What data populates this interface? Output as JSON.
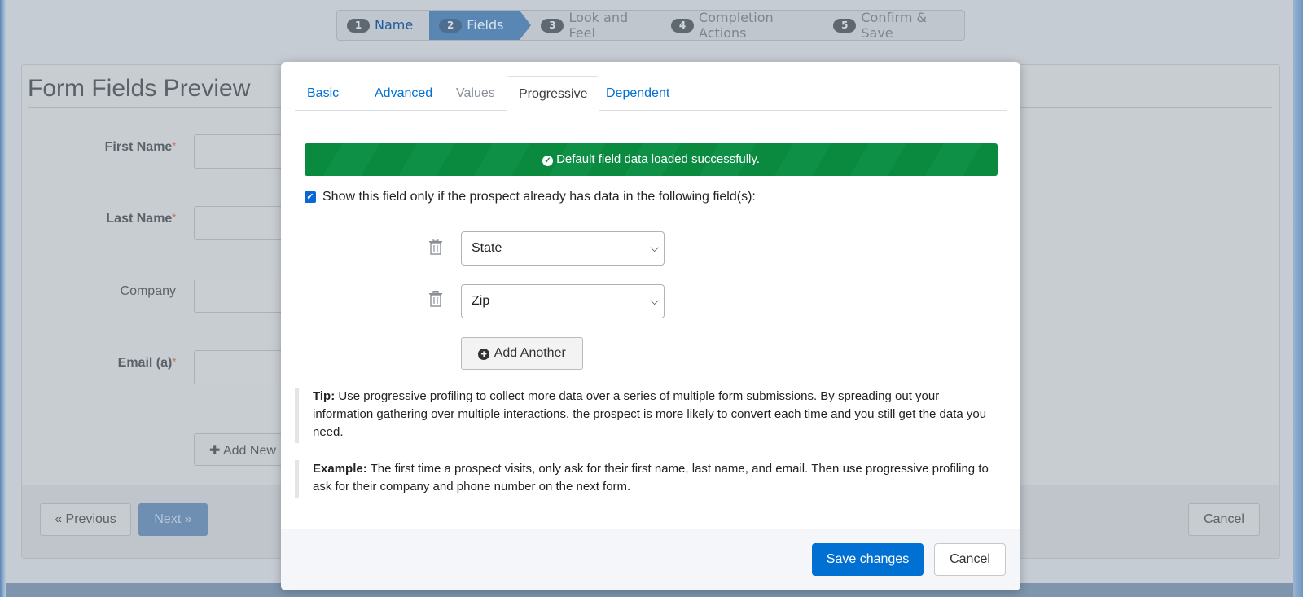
{
  "wizard": {
    "steps": [
      {
        "num": "1",
        "label": "Name"
      },
      {
        "num": "2",
        "label": "Fields"
      },
      {
        "num": "3",
        "label": "Look and Feel"
      },
      {
        "num": "4",
        "label": "Completion Actions"
      },
      {
        "num": "5",
        "label": "Confirm & Save"
      }
    ],
    "active_step": 2
  },
  "background": {
    "title": "Form Fields Preview",
    "fields": [
      {
        "label": "First Name",
        "required": "*"
      },
      {
        "label": "Last Name",
        "required": "*"
      },
      {
        "label": "Company",
        "required": ""
      },
      {
        "label": "Email (a)",
        "required": "*"
      }
    ],
    "add_new_label": "Add New",
    "prev_label": "« Previous",
    "next_label": "Next »",
    "cancel_label": "Cancel"
  },
  "modal": {
    "tabs": [
      {
        "label": "Basic"
      },
      {
        "label": "Advanced"
      },
      {
        "label": "Values"
      },
      {
        "label": "Progressive"
      },
      {
        "label": "Dependent"
      }
    ],
    "active_tab": "Progressive",
    "alert": "Default field data loaded successfully.",
    "checkbox_label": "Show this field only if the prospect already has data in the following field(s):",
    "checkbox_checked": true,
    "conditions": [
      {
        "value": "State"
      },
      {
        "value": "Zip"
      }
    ],
    "add_another_label": "Add Another",
    "tip": {
      "heading": "Tip:",
      "text": "Use progressive profiling to collect more data over a series of multiple form submissions. By spreading out your information gathering over multiple interactions, the prospect is more likely to convert each time and you still get the data you need."
    },
    "example": {
      "heading": "Example:",
      "text": "The first time a prospect visits, only ask for their first name, last name, and email. Then use progressive profiling to ask for their company and phone number on the next form."
    },
    "save_label": "Save changes",
    "cancel_label": "Cancel"
  },
  "colors": {
    "primary": "#0070d2",
    "success": "#0a8a3f",
    "wizard_active": "#5a86b3"
  }
}
